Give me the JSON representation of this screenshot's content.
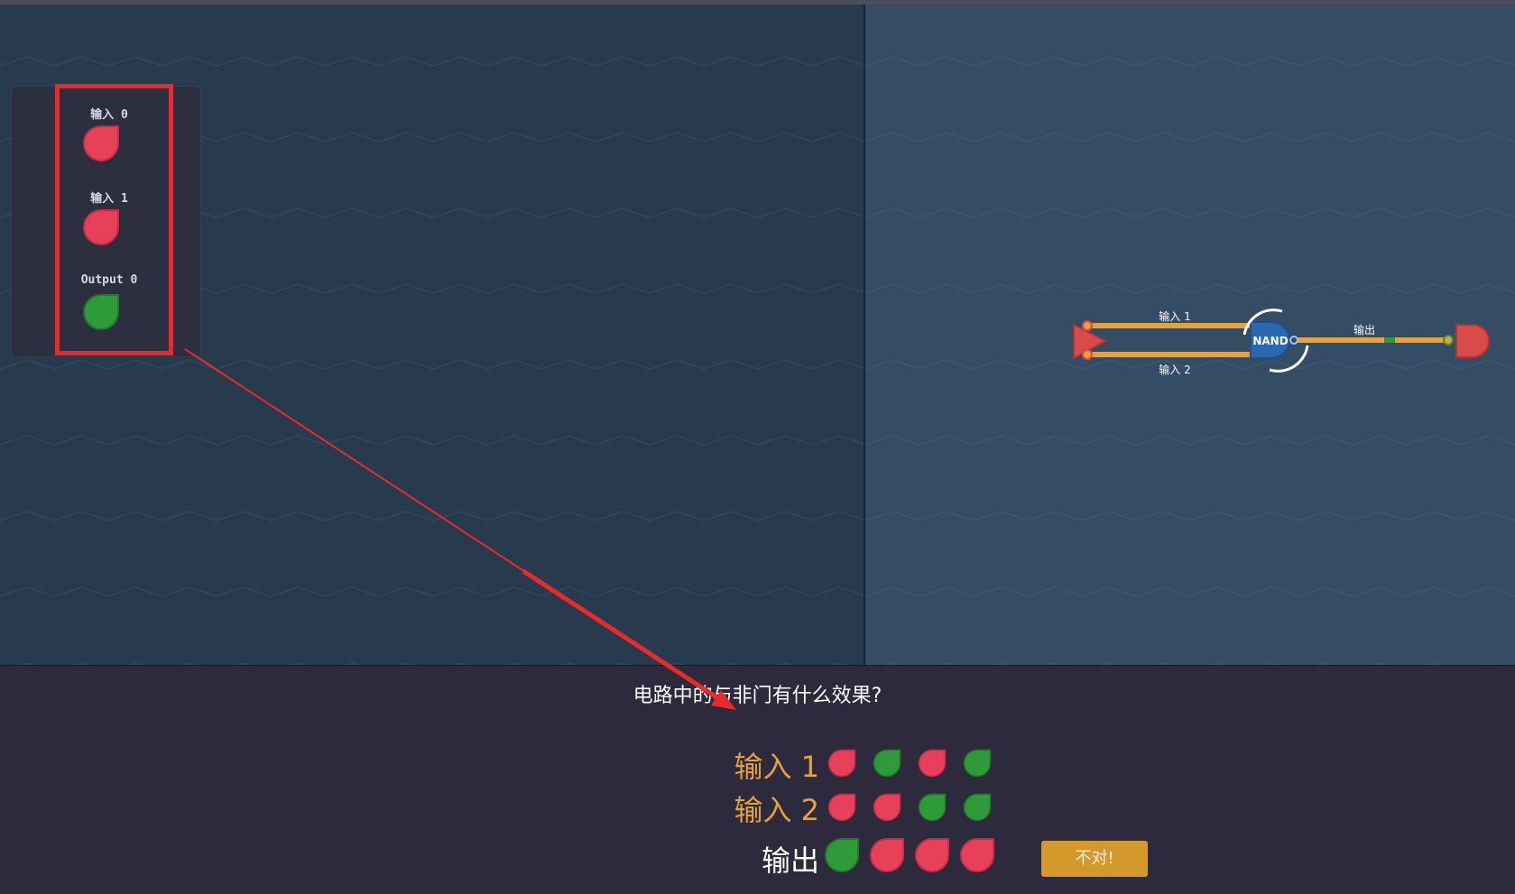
{
  "io_panel": {
    "items": [
      {
        "label": "输入 0",
        "state": "off"
      },
      {
        "label": "输入 1",
        "state": "off"
      },
      {
        "label": "Output 0",
        "state": "on"
      }
    ]
  },
  "circuit": {
    "gate_label": "NAND",
    "wire_input_1": "输入 1",
    "wire_input_2": "输入 2",
    "wire_output": "输出"
  },
  "quiz": {
    "question": "电路中的与非门有什么效果?",
    "rows": [
      {
        "label": "输入 1",
        "states": [
          "off",
          "on",
          "off",
          "on"
        ]
      },
      {
        "label": "输入 2",
        "states": [
          "off",
          "off",
          "on",
          "on"
        ]
      },
      {
        "label": "输出",
        "states": [
          "on",
          "off",
          "off",
          "off"
        ]
      }
    ],
    "feedback_button": "不对!"
  },
  "colors": {
    "led_off": "#e8405a",
    "led_on": "#2f9a3a",
    "wire": "#e8a13c",
    "gate": "#2a69b0",
    "annotation": "#ea2a2a"
  }
}
